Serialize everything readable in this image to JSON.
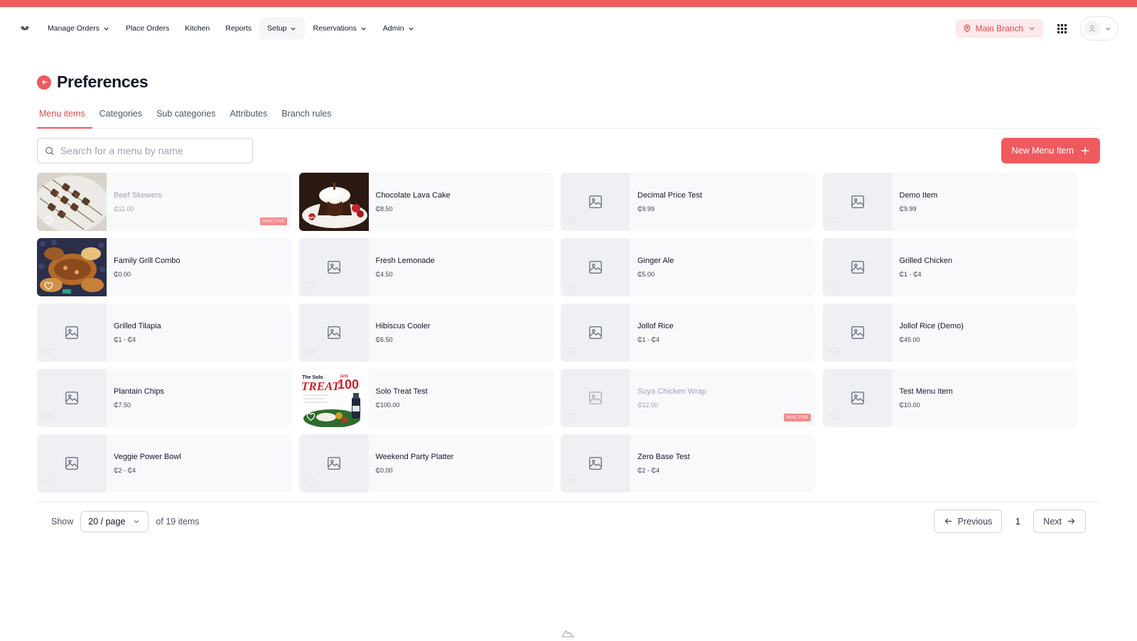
{
  "nav": {
    "items": [
      {
        "label": "Manage Orders",
        "dropdown": true
      },
      {
        "label": "Place Orders",
        "dropdown": false
      },
      {
        "label": "Kitchen",
        "dropdown": false
      },
      {
        "label": "Reports",
        "dropdown": false
      },
      {
        "label": "Setup",
        "dropdown": true
      },
      {
        "label": "Reservations",
        "dropdown": true
      },
      {
        "label": "Admin",
        "dropdown": true
      }
    ],
    "branch": "Main Branch"
  },
  "page": {
    "title": "Preferences",
    "tabs": [
      "Menu items",
      "Categories",
      "Sub categories",
      "Attributes",
      "Branch rules"
    ],
    "active_tab": "Menu items"
  },
  "search": {
    "placeholder": "Search for a menu by name",
    "value": ""
  },
  "new_button": "New Menu Item",
  "menu_items": [
    {
      "name": "Beef Skewers",
      "price": "₵11.00",
      "image": "photo-skewers",
      "inactive": true,
      "badge": "INACTIVE"
    },
    {
      "name": "Chocolate Lava Cake",
      "price": "₵8.50",
      "image": "photo-cake",
      "inactive": false
    },
    {
      "name": "Decimal Price Test",
      "price": "₵9.99",
      "image": "placeholder",
      "inactive": false
    },
    {
      "name": "Demo Item",
      "price": "₵9.99",
      "image": "placeholder",
      "inactive": false
    },
    {
      "name": "Family Grill Combo",
      "price": "₵0.00",
      "image": "photo-grill",
      "inactive": false
    },
    {
      "name": "Fresh Lemonade",
      "price": "₵4.50",
      "image": "placeholder",
      "inactive": false
    },
    {
      "name": "Ginger Ale",
      "price": "₵5.00",
      "image": "placeholder",
      "inactive": false
    },
    {
      "name": "Grilled Chicken",
      "price": "₵1 - ₵4",
      "image": "placeholder",
      "inactive": false
    },
    {
      "name": "Grilled Tilapia",
      "price": "₵1 - ₵4",
      "image": "placeholder",
      "inactive": false
    },
    {
      "name": "Hibiscus Cooler",
      "price": "₵6.50",
      "image": "placeholder",
      "inactive": false
    },
    {
      "name": "Jollof Rice",
      "price": "₵1 - ₵4",
      "image": "placeholder",
      "inactive": false
    },
    {
      "name": "Jollof Rice (Demo)",
      "price": "₵45.00",
      "image": "placeholder",
      "inactive": false
    },
    {
      "name": "Plantain Chips",
      "price": "₵7.50",
      "image": "placeholder",
      "inactive": false
    },
    {
      "name": "Solo Treat Test",
      "price": "₵100.00",
      "image": "photo-treat",
      "inactive": false
    },
    {
      "name": "Suya Chicken Wrap",
      "price": "₵12.00",
      "image": "placeholder",
      "inactive": true,
      "badge": "INACTIVE"
    },
    {
      "name": "Test Menu Item",
      "price": "₵10.00",
      "image": "placeholder",
      "inactive": false
    },
    {
      "name": "Veggie Power Bowl",
      "price": "₵2 - ₵4",
      "image": "placeholder",
      "inactive": false
    },
    {
      "name": "Weekend Party Platter",
      "price": "₵0.00",
      "image": "placeholder",
      "inactive": false
    },
    {
      "name": "Zero Base Test",
      "price": "₵2 - ₵4",
      "image": "placeholder",
      "inactive": false
    }
  ],
  "treat_image_text": {
    "line1": "The Solo",
    "line2": "TREAT",
    "ghs": "GHS",
    "amount": "100"
  },
  "pagination": {
    "show_label": "Show",
    "page_size": "20 / page",
    "total": "of 19 items",
    "previous": "Previous",
    "current_page": "1",
    "next": "Next"
  },
  "colors": {
    "accent": "#ef5a5f",
    "accent_text": "#e5484d",
    "card_bg": "#f8f9fb"
  }
}
